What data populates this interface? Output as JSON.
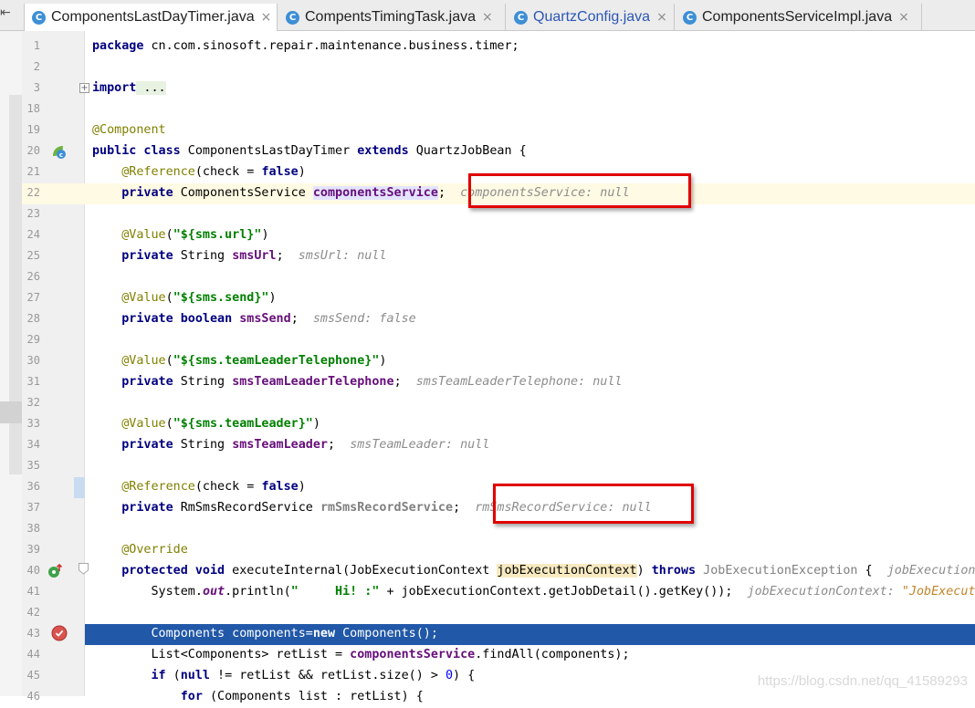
{
  "tabs": [
    {
      "label": "ComponentsLastDayTimer.java",
      "icon": "class-icon",
      "close": "×",
      "active": true
    },
    {
      "label": "CompentsTimingTask.java",
      "icon": "class-icon",
      "close": "×"
    },
    {
      "label": "QuartzConfig.java",
      "icon": "class-icon",
      "close": "×",
      "modified": true
    },
    {
      "label": "ComponentsServiceImpl.java",
      "icon": "class-icon",
      "close": "×"
    }
  ],
  "tab_icon_glyph": "C",
  "lines": [
    {
      "n": "1"
    },
    {
      "n": "2"
    },
    {
      "n": "3"
    },
    {
      "n": "18"
    },
    {
      "n": "19"
    },
    {
      "n": "20"
    },
    {
      "n": "21"
    },
    {
      "n": "22"
    },
    {
      "n": "23"
    },
    {
      "n": "24"
    },
    {
      "n": "25"
    },
    {
      "n": "26"
    },
    {
      "n": "27"
    },
    {
      "n": "28"
    },
    {
      "n": "29"
    },
    {
      "n": "30"
    },
    {
      "n": "31"
    },
    {
      "n": "32"
    },
    {
      "n": "33"
    },
    {
      "n": "34"
    },
    {
      "n": "35"
    },
    {
      "n": "36"
    },
    {
      "n": "37"
    },
    {
      "n": "38"
    },
    {
      "n": "39"
    },
    {
      "n": "40"
    },
    {
      "n": "41"
    },
    {
      "n": "42"
    },
    {
      "n": "43"
    },
    {
      "n": "44"
    },
    {
      "n": "45"
    },
    {
      "n": "46"
    }
  ],
  "code": {
    "l1_kw": "package",
    "l1_rest": " cn.com.sinosoft.repair.maintenance.business.timer;",
    "l3_kw": "import",
    "l3_fold": " ...",
    "l19_ann": "@Component",
    "l20_kw1": "public class",
    "l20_name": " ComponentsLastDayTimer ",
    "l20_kw2": "extends",
    "l20_rest": " QuartzJobBean {",
    "l21_ann": "@Reference",
    "l21_a": "(check = ",
    "l21_kw": "false",
    "l21_b": ")",
    "l22_kw": "private",
    "l22_type": " ComponentsService ",
    "l22_field": "componentsService",
    "l22_semi": ";",
    "l22_hint": "componentsService: null",
    "l24_ann": "@Value",
    "l24_a": "(",
    "l24_str": "\"${sms.url}\"",
    "l24_b": ")",
    "l25_kw": "private",
    "l25_type": " String ",
    "l25_field": "smsUrl",
    "l25_semi": ";",
    "l25_hint": "smsUrl: null",
    "l27_ann": "@Value",
    "l27_a": "(",
    "l27_str": "\"${sms.send}\"",
    "l27_b": ")",
    "l28_kw": "private boolean",
    "l28_sp": " ",
    "l28_field": "smsSend",
    "l28_semi": ";",
    "l28_hint": "smsSend: false",
    "l30_ann": "@Value",
    "l30_a": "(",
    "l30_str": "\"${sms.teamLeaderTelephone}\"",
    "l30_b": ")",
    "l31_kw": "private",
    "l31_type": " String ",
    "l31_field": "smsTeamLeaderTelephone",
    "l31_semi": ";",
    "l31_hint": "smsTeamLeaderTelephone: null",
    "l33_ann": "@Value",
    "l33_a": "(",
    "l33_str": "\"${sms.teamLeader}\"",
    "l33_b": ")",
    "l34_kw": "private",
    "l34_type": " String ",
    "l34_field": "smsTeamLeader",
    "l34_semi": ";",
    "l34_hint": "smsTeamLeader: null",
    "l36_ann": "@Reference",
    "l36_a": "(check = ",
    "l36_kw": "false",
    "l36_b": ")",
    "l37_kw": "private",
    "l37_type": " RmSmsRecordService ",
    "l37_field": "rmSmsRecordService",
    "l37_semi": ";",
    "l37_hint": "rmSmsRecordService: null",
    "l39_ann": "@Override",
    "l40_kw": "protected void",
    "l40_a": " executeInternal(JobExecutionContext ",
    "l40_param": "jobExecutionContext",
    "l40_b": ") ",
    "l40_kw2": "throws",
    "l40_c": " JobExecutionException",
    "l40_d": " {",
    "l40_hint": "jobExecutionC",
    "l41_a": "System.",
    "l41_out": "out",
    "l41_b": ".println(",
    "l41_str": "\"     Hi! :\"",
    "l41_c": " + jobExecutionContext.getJobDetail().getKey());",
    "l41_hint1": "jobExecutionContext: ",
    "l41_hint2": "\"JobExecuti",
    "l43_a": "Components components=",
    "l43_kw": "new",
    "l43_b": " Components();",
    "l44_a": "List<Components> retList = ",
    "l44_field": "componentsService",
    "l44_b": ".findAll(components);",
    "l45_kw1": "if",
    "l45_a": " (",
    "l45_kw2": "null",
    "l45_b": " != retList && retList.size() > ",
    "l45_num": "0",
    "l45_c": ") {",
    "l46_kw": "for",
    "l46_a": " (Components list : retList) {"
  },
  "watermark": "https://blog.csdn.net/qq_41589293",
  "colors": {
    "keyword": "#000080",
    "annotation": "#808000",
    "string": "#008000",
    "field": "#660e7a",
    "selection": "#2158a8",
    "caret_row": "#fffae3",
    "highlight_box": "#e00000"
  }
}
